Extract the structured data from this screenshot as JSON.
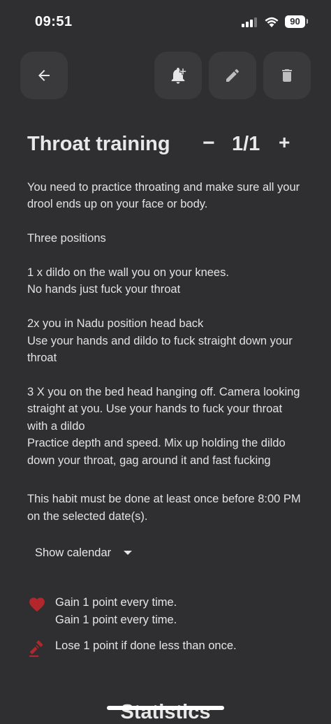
{
  "status": {
    "time": "09:51",
    "battery": "90"
  },
  "toolbar": {
    "back_icon": "arrow-left-icon",
    "reminder_icon": "bell-plus-icon",
    "edit_icon": "pencil-icon",
    "delete_icon": "trash-icon"
  },
  "habit": {
    "title": "Throat training",
    "counter_minus": "−",
    "counter_value": "1/1",
    "counter_plus": "+",
    "description": "You need to practice throating and make sure all your drool ends up on your face or body.\n\nThree positions\n\n1 x dildo on the wall you on your knees.\nNo hands just fuck your throat\n\n2x you in Nadu position head back\nUse your hands and dildo to fuck straight down your throat\n\n3 X you on the bed head hanging off. Camera looking straight at you. Use your hands to fuck your throat with a dildo\nPractice depth and speed. Mix up holding the dildo down your throat, gag around it and fast fucking",
    "rule": "This habit must be done at least once before 8:00 PM on the selected date(s)."
  },
  "calendar": {
    "label": "Show calendar"
  },
  "points": {
    "gain_line_1": "Gain 1 point every time.",
    "gain_line_2": "Gain 1 point every time.",
    "lose_line": "Lose 1 point if done less than once."
  },
  "statistics": {
    "label": "Statistics"
  },
  "colors": {
    "background": "#2f2f31",
    "button_bg": "#3a3a3c",
    "accent_red": "#b3262b",
    "text": "#e6e6e6"
  }
}
